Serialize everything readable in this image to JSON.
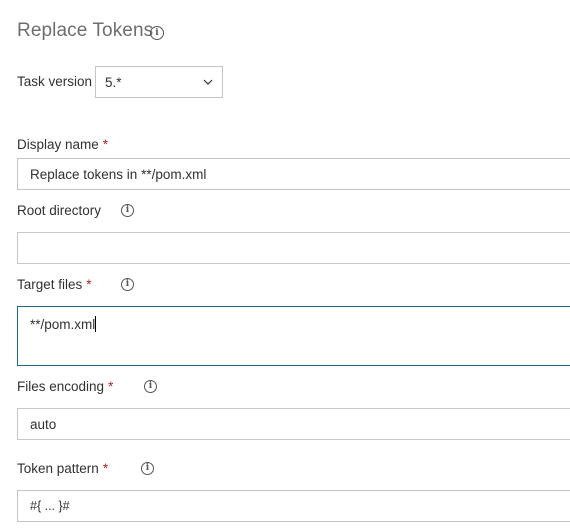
{
  "section": {
    "title": "Replace Tokens",
    "info_icon": "info-icon"
  },
  "task_version": {
    "label": "Task version",
    "value": "5.*"
  },
  "fields": {
    "display_name": {
      "label": "Display name",
      "required": "*",
      "value": "Replace tokens in **/pom.xml"
    },
    "root_directory": {
      "label": "Root directory",
      "value": ""
    },
    "target_files": {
      "label": "Target files",
      "required": "*",
      "value": "**/pom.xml"
    },
    "files_encoding": {
      "label": "Files encoding",
      "required": "*",
      "value": "auto"
    },
    "token_pattern": {
      "label": "Token pattern",
      "required": "*",
      "value": "#{ ... }#"
    }
  },
  "colors": {
    "border": "#c8c6c4",
    "focus_border": "#1b6d85",
    "required": "#a4262c",
    "title": "#6e6e6e"
  }
}
